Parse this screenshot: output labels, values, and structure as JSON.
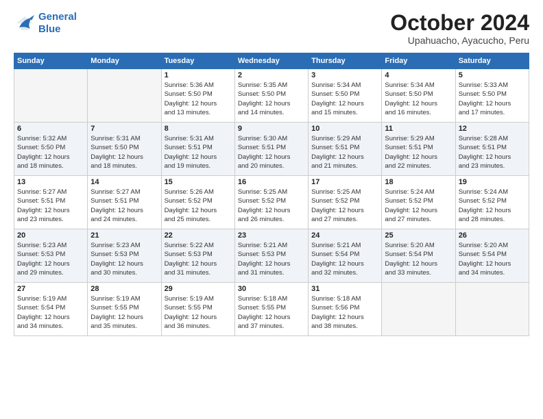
{
  "logo": {
    "line1": "General",
    "line2": "Blue"
  },
  "title": "October 2024",
  "subtitle": "Upahuacho, Ayacucho, Peru",
  "weekdays": [
    "Sunday",
    "Monday",
    "Tuesday",
    "Wednesday",
    "Thursday",
    "Friday",
    "Saturday"
  ],
  "weeks": [
    [
      {
        "day": "",
        "info": ""
      },
      {
        "day": "",
        "info": ""
      },
      {
        "day": "1",
        "info": "Sunrise: 5:36 AM\nSunset: 5:50 PM\nDaylight: 12 hours\nand 13 minutes."
      },
      {
        "day": "2",
        "info": "Sunrise: 5:35 AM\nSunset: 5:50 PM\nDaylight: 12 hours\nand 14 minutes."
      },
      {
        "day": "3",
        "info": "Sunrise: 5:34 AM\nSunset: 5:50 PM\nDaylight: 12 hours\nand 15 minutes."
      },
      {
        "day": "4",
        "info": "Sunrise: 5:34 AM\nSunset: 5:50 PM\nDaylight: 12 hours\nand 16 minutes."
      },
      {
        "day": "5",
        "info": "Sunrise: 5:33 AM\nSunset: 5:50 PM\nDaylight: 12 hours\nand 17 minutes."
      }
    ],
    [
      {
        "day": "6",
        "info": "Sunrise: 5:32 AM\nSunset: 5:50 PM\nDaylight: 12 hours\nand 18 minutes."
      },
      {
        "day": "7",
        "info": "Sunrise: 5:31 AM\nSunset: 5:50 PM\nDaylight: 12 hours\nand 18 minutes."
      },
      {
        "day": "8",
        "info": "Sunrise: 5:31 AM\nSunset: 5:51 PM\nDaylight: 12 hours\nand 19 minutes."
      },
      {
        "day": "9",
        "info": "Sunrise: 5:30 AM\nSunset: 5:51 PM\nDaylight: 12 hours\nand 20 minutes."
      },
      {
        "day": "10",
        "info": "Sunrise: 5:29 AM\nSunset: 5:51 PM\nDaylight: 12 hours\nand 21 minutes."
      },
      {
        "day": "11",
        "info": "Sunrise: 5:29 AM\nSunset: 5:51 PM\nDaylight: 12 hours\nand 22 minutes."
      },
      {
        "day": "12",
        "info": "Sunrise: 5:28 AM\nSunset: 5:51 PM\nDaylight: 12 hours\nand 23 minutes."
      }
    ],
    [
      {
        "day": "13",
        "info": "Sunrise: 5:27 AM\nSunset: 5:51 PM\nDaylight: 12 hours\nand 23 minutes."
      },
      {
        "day": "14",
        "info": "Sunrise: 5:27 AM\nSunset: 5:51 PM\nDaylight: 12 hours\nand 24 minutes."
      },
      {
        "day": "15",
        "info": "Sunrise: 5:26 AM\nSunset: 5:52 PM\nDaylight: 12 hours\nand 25 minutes."
      },
      {
        "day": "16",
        "info": "Sunrise: 5:25 AM\nSunset: 5:52 PM\nDaylight: 12 hours\nand 26 minutes."
      },
      {
        "day": "17",
        "info": "Sunrise: 5:25 AM\nSunset: 5:52 PM\nDaylight: 12 hours\nand 27 minutes."
      },
      {
        "day": "18",
        "info": "Sunrise: 5:24 AM\nSunset: 5:52 PM\nDaylight: 12 hours\nand 27 minutes."
      },
      {
        "day": "19",
        "info": "Sunrise: 5:24 AM\nSunset: 5:52 PM\nDaylight: 12 hours\nand 28 minutes."
      }
    ],
    [
      {
        "day": "20",
        "info": "Sunrise: 5:23 AM\nSunset: 5:53 PM\nDaylight: 12 hours\nand 29 minutes."
      },
      {
        "day": "21",
        "info": "Sunrise: 5:23 AM\nSunset: 5:53 PM\nDaylight: 12 hours\nand 30 minutes."
      },
      {
        "day": "22",
        "info": "Sunrise: 5:22 AM\nSunset: 5:53 PM\nDaylight: 12 hours\nand 31 minutes."
      },
      {
        "day": "23",
        "info": "Sunrise: 5:21 AM\nSunset: 5:53 PM\nDaylight: 12 hours\nand 31 minutes."
      },
      {
        "day": "24",
        "info": "Sunrise: 5:21 AM\nSunset: 5:54 PM\nDaylight: 12 hours\nand 32 minutes."
      },
      {
        "day": "25",
        "info": "Sunrise: 5:20 AM\nSunset: 5:54 PM\nDaylight: 12 hours\nand 33 minutes."
      },
      {
        "day": "26",
        "info": "Sunrise: 5:20 AM\nSunset: 5:54 PM\nDaylight: 12 hours\nand 34 minutes."
      }
    ],
    [
      {
        "day": "27",
        "info": "Sunrise: 5:19 AM\nSunset: 5:54 PM\nDaylight: 12 hours\nand 34 minutes."
      },
      {
        "day": "28",
        "info": "Sunrise: 5:19 AM\nSunset: 5:55 PM\nDaylight: 12 hours\nand 35 minutes."
      },
      {
        "day": "29",
        "info": "Sunrise: 5:19 AM\nSunset: 5:55 PM\nDaylight: 12 hours\nand 36 minutes."
      },
      {
        "day": "30",
        "info": "Sunrise: 5:18 AM\nSunset: 5:55 PM\nDaylight: 12 hours\nand 37 minutes."
      },
      {
        "day": "31",
        "info": "Sunrise: 5:18 AM\nSunset: 5:56 PM\nDaylight: 12 hours\nand 38 minutes."
      },
      {
        "day": "",
        "info": ""
      },
      {
        "day": "",
        "info": ""
      }
    ]
  ]
}
